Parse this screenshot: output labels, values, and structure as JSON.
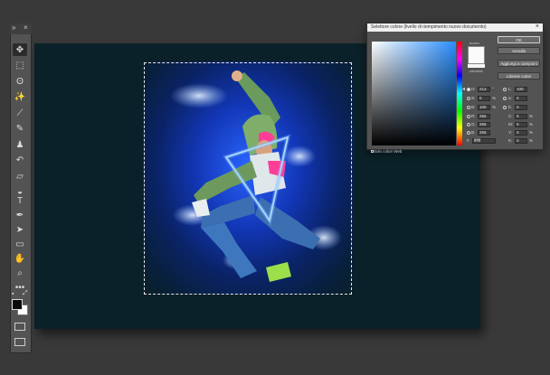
{
  "tools_panel": {
    "collapse_label": "»",
    "close_label": "×",
    "tools": [
      {
        "name": "move-tool",
        "glyph": "✥"
      },
      {
        "name": "marquee-tool",
        "glyph": "⬚"
      },
      {
        "name": "lasso-tool",
        "glyph": "ʘ"
      },
      {
        "name": "magic-wand-tool",
        "glyph": "✨"
      },
      {
        "name": "eyedropper-tool",
        "glyph": "⟋"
      },
      {
        "name": "brush-tool",
        "glyph": "✎"
      },
      {
        "name": "stamp-tool",
        "glyph": "♟"
      },
      {
        "name": "history-brush-tool",
        "glyph": "↶"
      },
      {
        "name": "eraser-tool",
        "glyph": "▱"
      },
      {
        "name": "gradient-tool",
        "glyph": "◒"
      },
      {
        "name": "type-tool",
        "glyph": "T"
      },
      {
        "name": "pen-tool",
        "glyph": "✒"
      },
      {
        "name": "path-selection-tool",
        "glyph": "➤"
      },
      {
        "name": "shape-tool",
        "glyph": "▭"
      },
      {
        "name": "hand-tool",
        "glyph": "✋"
      },
      {
        "name": "zoom-tool",
        "glyph": "⌕"
      },
      {
        "name": "more-tools",
        "glyph": "•••"
      }
    ],
    "foreground_color": "#0a0a0a",
    "background_color": "#ffffff"
  },
  "color_picker": {
    "title": "Selettore colore (livello di riempimento nuovo documento)",
    "close": "×",
    "new_label": "nuovo",
    "current_label": "corrente",
    "selected_color": "#fafafa",
    "buttons": {
      "ok": "OK",
      "cancel": "Annulla",
      "add_to_swatches": "Aggiungi a campioni",
      "color_libraries": "Librerie colori"
    },
    "hsb": [
      {
        "key": "H:",
        "value": "213",
        "unit": "°"
      },
      {
        "key": "S:",
        "value": "0",
        "unit": "%"
      },
      {
        "key": "B:",
        "value": "100",
        "unit": "%"
      }
    ],
    "rgb": [
      {
        "key": "R:",
        "value": "255",
        "unit": ""
      },
      {
        "key": "G:",
        "value": "255",
        "unit": ""
      },
      {
        "key": "B:",
        "value": "255",
        "unit": ""
      }
    ],
    "lab": [
      {
        "key": "L:",
        "value": "100"
      },
      {
        "key": "a:",
        "value": "0"
      },
      {
        "key": "b:",
        "value": "0"
      }
    ],
    "cmyk": [
      {
        "key": "C:",
        "value": "0",
        "unit": "%"
      },
      {
        "key": "M:",
        "value": "0",
        "unit": "%"
      },
      {
        "key": "Y:",
        "value": "0",
        "unit": "%"
      },
      {
        "key": "K:",
        "value": "0",
        "unit": "%"
      }
    ],
    "hex_label": "#",
    "hex_value": "ffffff",
    "web_only_label": "Solo colori Web"
  }
}
